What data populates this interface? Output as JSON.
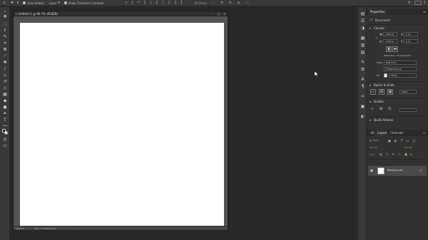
{
  "options_bar": {
    "auto_select_label": "Auto-Select:",
    "layer_dropdown_value": "Layer",
    "transform_controls_label": "Show Transform Controls",
    "mode_3d_label": "3D Mode:"
  },
  "toolbar": {
    "tools": [
      {
        "name": "move-tool-icon",
        "glyph": "✥"
      },
      {
        "name": "marquee-tool-icon",
        "glyph": "⬚"
      },
      {
        "name": "lasso-tool-icon",
        "glyph": "ℓ"
      },
      {
        "name": "quick-select-tool-icon",
        "glyph": "✎"
      },
      {
        "name": "crop-tool-icon",
        "glyph": "⌗"
      },
      {
        "name": "frame-tool-icon",
        "glyph": "⊠"
      },
      {
        "name": "eyedropper-tool-icon",
        "glyph": "⁄"
      },
      {
        "name": "healing-brush-tool-icon",
        "glyph": "✚"
      },
      {
        "name": "brush-tool-icon",
        "glyph": "/"
      },
      {
        "name": "clone-stamp-tool-icon",
        "glyph": "⊥"
      },
      {
        "name": "history-brush-tool-icon",
        "glyph": "↺"
      },
      {
        "name": "eraser-tool-icon",
        "glyph": "◇"
      },
      {
        "name": "gradient-tool-icon",
        "glyph": "▦"
      },
      {
        "name": "blur-tool-icon",
        "glyph": "◆"
      },
      {
        "name": "dodge-tool-icon",
        "glyph": "●"
      },
      {
        "name": "pen-tool-icon",
        "glyph": "✒"
      },
      {
        "name": "type-tool-icon",
        "glyph": "T"
      },
      {
        "name": "path-selection-tool-icon",
        "glyph": "➤"
      },
      {
        "name": "rectangle-tool-icon",
        "glyph": "□"
      },
      {
        "name": "hand-tool-icon",
        "glyph": "✋"
      },
      {
        "name": "zoom-tool-icon",
        "glyph": "⚲"
      },
      {
        "name": "more-tools-icon",
        "glyph": "…"
      }
    ]
  },
  "document": {
    "title": "Untitled-1 @ 66.7% (RGB/8)",
    "zoom": "66.67%",
    "doc_info": "Doc: 4.12M/0 bytes"
  },
  "properties": {
    "tab_label": "Properties",
    "doc_label": "Document",
    "canvas_section": "Canvas",
    "width_label": "W",
    "width_value": "1200 px",
    "height_label": "H",
    "height_value": "1200 px",
    "x_label": "X",
    "x_value": "0 px",
    "y_label": "Y",
    "y_value": "0 px",
    "resolution": "Resolution: 72 pixels/inch",
    "mode_label": "Mode",
    "mode_value": "RGB Color",
    "bits_value": "8 Bits/Channel",
    "fill_label": "Fill",
    "fill_value": "White",
    "rulers_section": "Rulers & Grids",
    "units_value": "Pixels",
    "guides_section": "Guides",
    "quick_actions_section": "Quick Actions"
  },
  "layers_panel": {
    "tab_3d": "3D",
    "tab_layers": "Layers",
    "tab_channels": "Channels",
    "search_placeholder": "Kind",
    "blend_mode": "Normal",
    "opacity_label": "Opacity:",
    "lock_label": "Lock:",
    "fill_label": "Fill:",
    "layer_name": "Background"
  }
}
